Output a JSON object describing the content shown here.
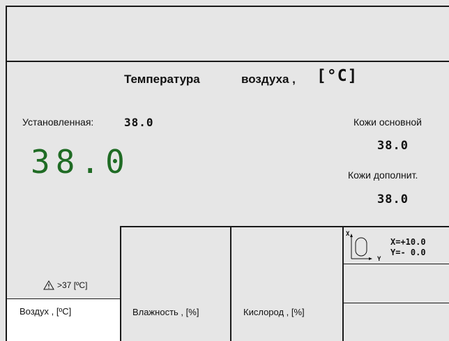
{
  "main": {
    "title": "Температура",
    "title_sub": "воздуха ,",
    "unit": "[°C]",
    "set_label": "Установленная:",
    "set_value": "38.0",
    "big_value": "38.0",
    "skin_main_label": "Кожи основной",
    "skin_main_value": "38.0",
    "skin_aux_label": "Кожи дополнит.",
    "skin_aux_value": "38.0"
  },
  "position": {
    "x_axis": "X",
    "y_axis": "Y",
    "x_readout": "X=+10.0",
    "y_readout": "Y=- 0.0"
  },
  "alarm": {
    "label": ">37 [ºC]"
  },
  "tabs": [
    {
      "label": "Воздух , [ºC]"
    },
    {
      "label": "Влажность , [%]"
    },
    {
      "label": "Кислород , [%]"
    }
  ],
  "colors": {
    "big_value": "#1f6b24",
    "background": "#e6e6e6",
    "active_tab": "#ffffff"
  },
  "icons": [
    "warning-icon",
    "position-indicator-icon"
  ]
}
